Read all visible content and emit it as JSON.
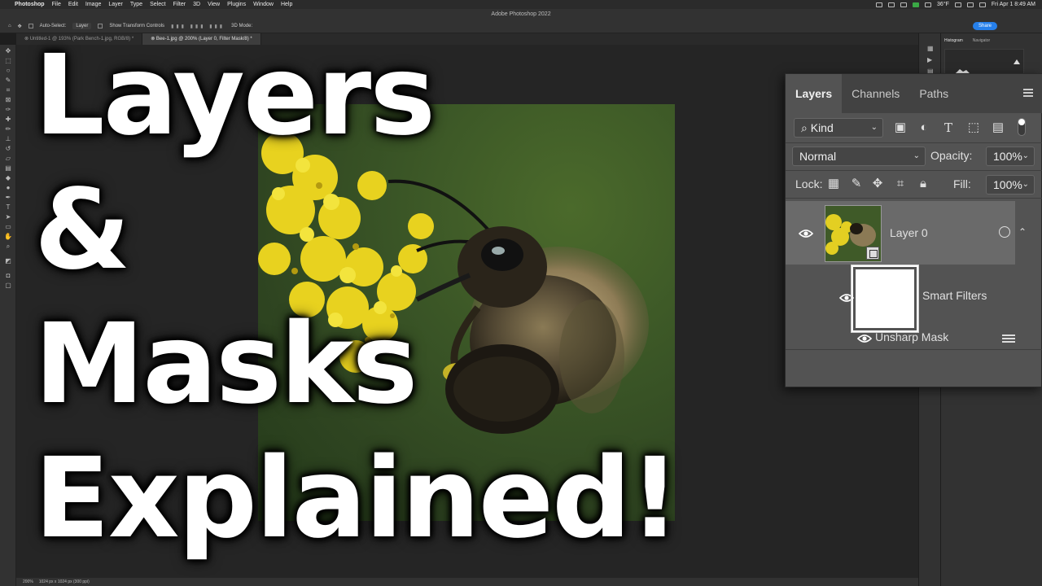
{
  "menubar": {
    "app": "Photoshop",
    "items": [
      "File",
      "Edit",
      "Image",
      "Layer",
      "Type",
      "Select",
      "Filter",
      "3D",
      "View",
      "Plugins",
      "Window",
      "Help"
    ],
    "temperature": "36°F",
    "datetime": "Fri Apr 1  8:49 AM"
  },
  "window_title": "Adobe Photoshop 2022",
  "options": {
    "auto_select_label": "Auto-Select:",
    "auto_select_value": "Layer",
    "show_transform_label": "Show Transform Controls",
    "mode_3d": "3D Mode:",
    "share_label": "Share"
  },
  "tabs": [
    {
      "label": "Untitled-1 @ 193% (Park Bench-1.jpg, RGB/8) *",
      "active": false
    },
    {
      "label": "Bee-1.jpg @ 200% (Layer 0, Filter Mask/8) *",
      "active": true
    }
  ],
  "overlay_title": {
    "line1": "Layers",
    "line2": "&",
    "line3": "Masks",
    "line4": "Explained!"
  },
  "mini_panel": {
    "tabs": [
      "Histogram",
      "Navigator"
    ]
  },
  "layers_panel": {
    "tabs": [
      "Layers",
      "Channels",
      "Paths"
    ],
    "filter_kind": "Kind",
    "blend_mode": "Normal",
    "opacity_label": "Opacity:",
    "opacity_value": "100%",
    "lock_label": "Lock:",
    "fill_label": "Fill:",
    "fill_value": "100%",
    "layer_name": "Layer 0",
    "smart_filters_label": "Smart Filters",
    "filter_name": "Unsharp Mask"
  },
  "status": {
    "zoom": "200%",
    "doc_info": "1024 px x 1024 px (300 ppi)"
  },
  "colors": {
    "panel_bg": "#535353",
    "selected_layer": "#6a6a6a",
    "accent_share": "#2680eb"
  }
}
